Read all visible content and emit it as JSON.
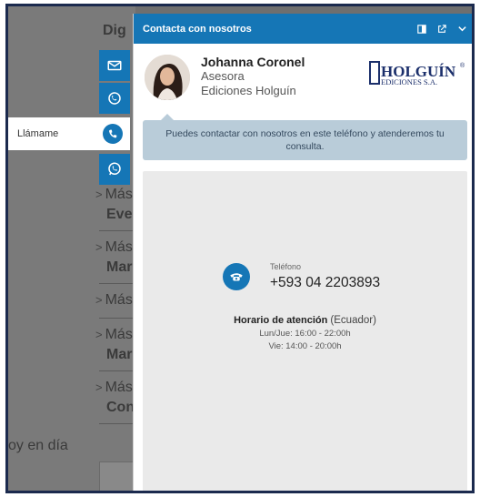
{
  "background": {
    "title": "Dig",
    "items": [
      {
        "label": "Más",
        "sub": "Eve"
      },
      {
        "label": "Más",
        "sub": "Mar"
      },
      {
        "label": "Más",
        "sub": ""
      },
      {
        "label": "Más",
        "sub": "Mar"
      },
      {
        "label": "Más",
        "sub": "Con"
      }
    ],
    "footer_text": "oy en día"
  },
  "launcher": {
    "llamame_label": "Llámame",
    "buttons": [
      "mail-icon",
      "callback-icon",
      "phone-icon",
      "whatsapp-icon"
    ],
    "accent": "#1576b6"
  },
  "widget": {
    "title": "Contacta con nosotros",
    "header_icons": [
      "popout-panel-icon",
      "external-link-icon",
      "chevron-down-icon"
    ],
    "agent": {
      "name": "Johanna Coronel",
      "role": "Asesora",
      "company": "Ediciones Holguín"
    },
    "logo": {
      "main": "HOLGUÍN",
      "sub": "EDICIONES S.A.",
      "mark": "®"
    },
    "notice": "Puedes contactar con nosotros en este teléfono y atenderemos tu consulta.",
    "phone": {
      "label": "Teléfono",
      "number": "+593 04 2203893"
    },
    "schedule": {
      "title": "Horario de atención",
      "region": "(Ecuador)",
      "lines": [
        "Lun/Jue: 16:00 - 22:00h",
        "Vie: 14:00 - 20:00h"
      ]
    }
  }
}
